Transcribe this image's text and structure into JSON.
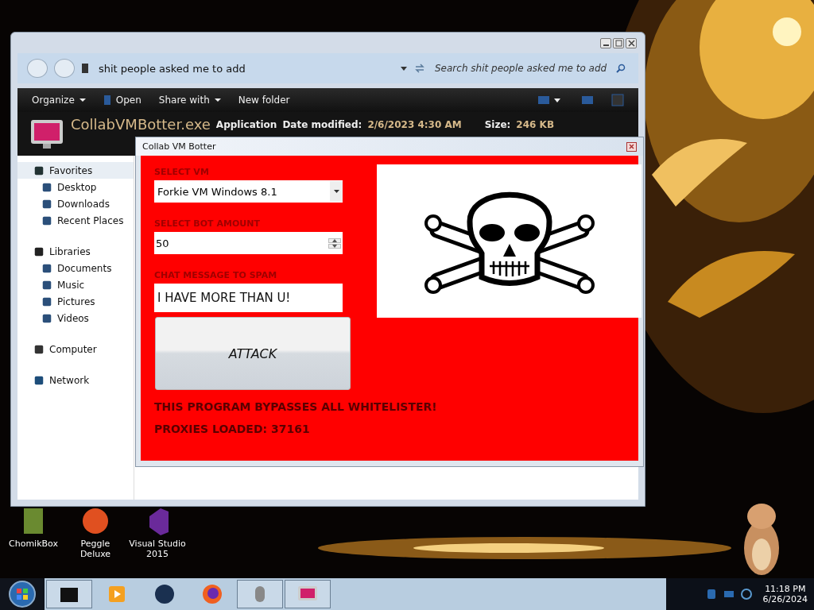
{
  "explorer": {
    "address": "shit people asked me to add",
    "search": {
      "placeholder": "Search shit people asked me to add"
    },
    "toolbar": [
      {
        "label": "Organize",
        "kind": "menu"
      },
      {
        "label": "Open",
        "kind": "open"
      },
      {
        "label": "Share with",
        "kind": "menu"
      },
      {
        "label": "New folder",
        "kind": "plain"
      }
    ],
    "details": {
      "name": "CollabVMBotter.exe",
      "type": "Application",
      "date_label": "Date modified:",
      "date": "2/6/2023 4:30 AM",
      "size_label": "Size:",
      "size": "246 KB"
    },
    "sidebar": [
      {
        "label": "Favorites",
        "selected": true,
        "children": [
          {
            "label": "Desktop",
            "selected": false
          },
          {
            "label": "Downloads",
            "selected": false
          },
          {
            "label": "Recent Places",
            "selected": false
          }
        ]
      },
      {
        "label": "Libraries",
        "selected": false,
        "children": [
          {
            "label": "Documents",
            "selected": false
          },
          {
            "label": "Music",
            "selected": false
          },
          {
            "label": "Pictures",
            "selected": false
          },
          {
            "label": "Videos",
            "selected": false
          }
        ]
      },
      {
        "label": "Computer",
        "selected": false
      },
      {
        "label": "Network",
        "selected": false
      }
    ]
  },
  "dialog": {
    "title": "Collab VM Botter",
    "vm_label": "SELECT VM",
    "vm": "Forkie VM Windows 8.1",
    "bot_label": "SELECT BOT AMOUNT",
    "bots": "50",
    "chat_label": "CHAT MESSAGE TO SPAM",
    "chat": "I HAVE MORE THAN U!",
    "button": "ATTACK",
    "notes": [
      "THIS PROGRAM BYPASSES ALL WHITELISTER!",
      "PROXIES LOADED: 37161"
    ]
  },
  "desktop": {
    "icons": [
      {
        "label": "ChomikBox"
      },
      {
        "label": "Peggle Deluxe"
      },
      {
        "label": "Visual Studio 2015"
      }
    ]
  },
  "taskbar": {
    "time": "11:18 PM",
    "date": "6/26/2024"
  }
}
